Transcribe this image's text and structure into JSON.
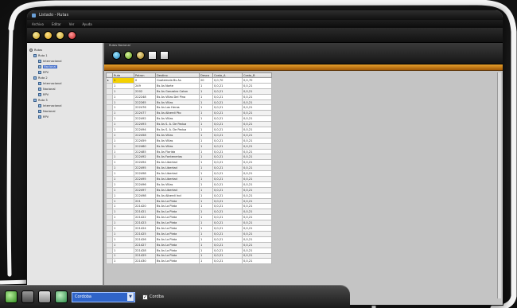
{
  "window": {
    "title": "Listado - Rutas",
    "menu": [
      "Archivo",
      "Editar",
      "Ver",
      "Ayuda"
    ]
  },
  "toolbar": {
    "buttons": [
      "back-icon",
      "folder-icon",
      "print-icon",
      "stop-icon"
    ]
  },
  "tree": {
    "root": "Rutas",
    "nodes": [
      {
        "label": "Ruta 1",
        "level": 1
      },
      {
        "label": "Internacional",
        "level": 2
      },
      {
        "label": "Nacional",
        "level": 2,
        "selected": true
      },
      {
        "label": "RPV",
        "level": 2
      },
      {
        "label": "Ruta 2",
        "level": 1
      },
      {
        "label": "Internacional",
        "level": 2
      },
      {
        "label": "Nacional",
        "level": 2
      },
      {
        "label": "RPV",
        "level": 2
      },
      {
        "label": "Ruta 3",
        "level": 1
      },
      {
        "label": "Internacional",
        "level": 2
      },
      {
        "label": "Nacional",
        "level": 2
      },
      {
        "label": "RPV",
        "level": 2
      }
    ]
  },
  "panel": {
    "caption": "Rutas Nacional",
    "strip_label": "Ruta",
    "icons": [
      "refresh-icon",
      "add-icon",
      "edit-icon",
      "document-icon",
      "export-icon"
    ]
  },
  "grid": {
    "columns": [
      "Ruta",
      "Patron",
      "Destino",
      "Desca",
      "Costo_A",
      "Costo_B"
    ],
    "rows": [
      [
        "1",
        "0",
        "Guatemala Bs As",
        "20",
        "0,0,70",
        "0,0,70"
      ],
      [
        "1",
        "249",
        "Bs As Norte",
        "1",
        "0,0,21",
        "0,0,21"
      ],
      [
        "1",
        "2202",
        "Bs As Gonzalez Catan",
        "1",
        "0,0,21",
        "0,0,21"
      ],
      [
        "1",
        "222248",
        "Bs As Villas Del Pino",
        "1",
        "0,0,21",
        "0,0,21"
      ],
      [
        "1",
        "222265",
        "Bs As Villas",
        "1",
        "0,0,21",
        "0,0,21"
      ],
      [
        "1",
        "222476",
        "Bs As Las Heras",
        "1",
        "0,0,21",
        "0,0,21"
      ],
      [
        "1",
        "222477",
        "Bs As Alberdi Pto",
        "1",
        "0,0,21",
        "0,0,21"
      ],
      [
        "1",
        "222492",
        "Bs As Villas",
        "1",
        "0,0,21",
        "0,0,21"
      ],
      [
        "1",
        "222493",
        "Bs As S. A. De Padua",
        "1",
        "0,0,21",
        "0,0,21"
      ],
      [
        "1",
        "222494",
        "Bs As S. A. De Padua",
        "1",
        "0,0,21",
        "0,0,21"
      ],
      [
        "1",
        "222458",
        "Bs As Villas",
        "1",
        "0,0,21",
        "0,0,21"
      ],
      [
        "1",
        "222459",
        "Bs As Villas",
        "1",
        "0,0,21",
        "0,0,21"
      ],
      [
        "1",
        "222460",
        "Bs As Villas",
        "1",
        "0,0,21",
        "0,0,21"
      ],
      [
        "1",
        "222485",
        "Bs As Florida",
        "1",
        "0,0,21",
        "0,0,21"
      ],
      [
        "1",
        "222492",
        "Bs As Fontenerias",
        "1",
        "0,0,21",
        "0,0,21"
      ],
      [
        "1",
        "222494",
        "Bs As Libertad",
        "1",
        "0,0,21",
        "0,0,21"
      ],
      [
        "1",
        "222495",
        "Bs As Libertad",
        "1",
        "0,0,21",
        "0,0,21"
      ],
      [
        "1",
        "222498",
        "Bs As Libertad",
        "1",
        "0,0,21",
        "0,0,21"
      ],
      [
        "1",
        "222495",
        "Bs As Libertad",
        "1",
        "0,0,21",
        "0,0,21"
      ],
      [
        "1",
        "222496",
        "Bs As Villas",
        "1",
        "0,0,21",
        "0,0,21"
      ],
      [
        "1",
        "222497",
        "Bs As Libertad",
        "1",
        "0,0,21",
        "0,0,21"
      ],
      [
        "1",
        "222498",
        "Bs As Alberdi Incl",
        "1",
        "0,0,21",
        "0,0,21"
      ],
      [
        "1",
        "221",
        "Bs As La Plata",
        "1",
        "0,0,21",
        "0,0,21"
      ],
      [
        "1",
        "221420",
        "Bs As La Plata",
        "1",
        "0,0,21",
        "0,0,21"
      ],
      [
        "1",
        "221421",
        "Bs As La Plata",
        "1",
        "0,0,21",
        "0,0,21"
      ],
      [
        "1",
        "221422",
        "Bs As La Plata",
        "1",
        "0,0,21",
        "0,0,21"
      ],
      [
        "1",
        "221423",
        "Bs As La Plata",
        "1",
        "0,0,21",
        "0,0,21"
      ],
      [
        "1",
        "221424",
        "Bs As La Plata",
        "1",
        "0,0,21",
        "0,0,21"
      ],
      [
        "1",
        "221425",
        "Bs As La Plata",
        "1",
        "0,0,21",
        "0,0,21"
      ],
      [
        "1",
        "221426",
        "Bs As La Plata",
        "1",
        "0,0,21",
        "0,0,21"
      ],
      [
        "1",
        "221427",
        "Bs As La Plata",
        "1",
        "0,0,21",
        "0,0,21"
      ],
      [
        "1",
        "221428",
        "Bs As La Plata",
        "1",
        "0,0,21",
        "0,0,21"
      ],
      [
        "1",
        "221429",
        "Bs As La Plata",
        "1",
        "0,0,21",
        "0,0,21"
      ],
      [
        "1",
        "221430",
        "Bs As La Plata",
        "1",
        "0,0,21",
        "0,0,21"
      ]
    ]
  },
  "taskbar": {
    "buttons": [
      "start-icon",
      "window-icon",
      "folder-icon",
      "network-icon"
    ],
    "combo_value": "Cordoba",
    "checkbox_label": "Cordba",
    "checkbox_checked": true
  },
  "colors": {
    "accent_orange": "#e6a02c",
    "selected_blue": "#3a67c8",
    "highlight_yellow": "#f4d100"
  }
}
